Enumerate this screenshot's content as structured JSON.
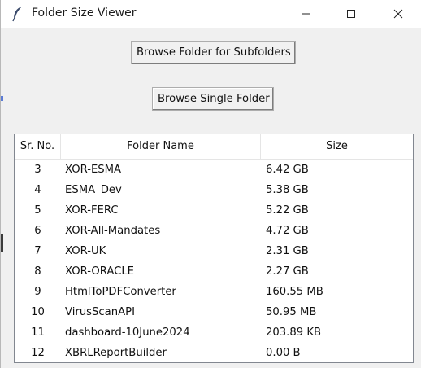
{
  "window": {
    "title": "Folder Size Viewer",
    "icon": "feather-icon",
    "controls": {
      "minimize": "—",
      "maximize": "☐",
      "close": "✕"
    }
  },
  "buttons": {
    "browse_subfolders": "Browse Folder for Subfolders",
    "browse_single": "Browse Single Folder"
  },
  "table": {
    "columns": [
      "Sr. No.",
      "Folder Name",
      "Size"
    ],
    "rows": [
      {
        "sr": "3",
        "name": "XOR-ESMA",
        "size": "6.42 GB"
      },
      {
        "sr": "4",
        "name": "ESMA_Dev",
        "size": "5.38 GB"
      },
      {
        "sr": "5",
        "name": "XOR-FERC",
        "size": "5.22 GB"
      },
      {
        "sr": "6",
        "name": "XOR-All-Mandates",
        "size": "4.72 GB"
      },
      {
        "sr": "7",
        "name": "XOR-UK",
        "size": "2.31 GB"
      },
      {
        "sr": "8",
        "name": "XOR-ORACLE",
        "size": "2.27 GB"
      },
      {
        "sr": "9",
        "name": "HtmlToPDFConverter",
        "size": "160.55 MB"
      },
      {
        "sr": "10",
        "name": "VirusScanAPI",
        "size": "50.95 MB"
      },
      {
        "sr": "11",
        "name": "dashboard-10June2024",
        "size": "203.89 KB"
      },
      {
        "sr": "12",
        "name": "XBRLReportBuilder",
        "size": "0.00 B"
      }
    ]
  }
}
